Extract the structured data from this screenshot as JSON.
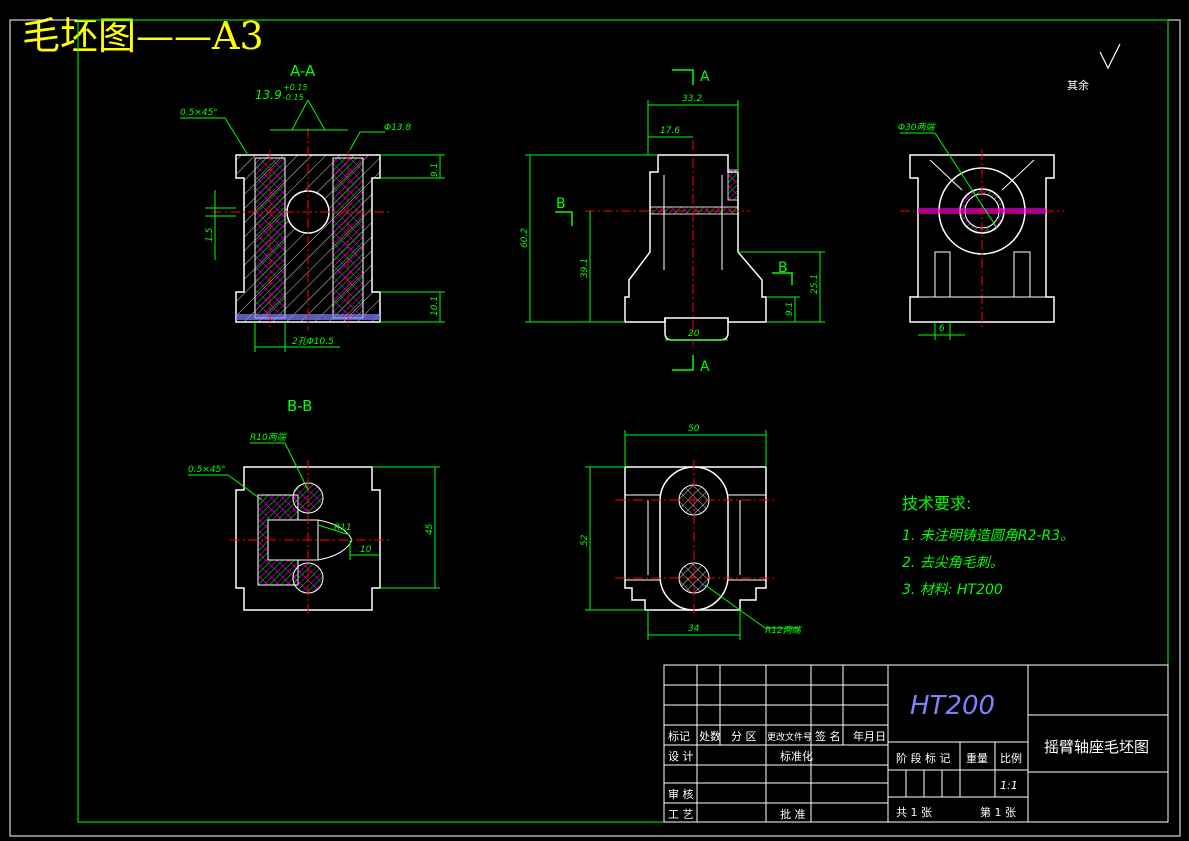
{
  "sheet_header": "毛坯图——A3",
  "views": {
    "section_aa": {
      "title": "A-A",
      "chamfer": "0.5×45°",
      "tolerance_dim": "13.9",
      "tol_upper": "+0.15",
      "tol_lower": "-0.15",
      "dia_hole": "Φ13.8",
      "dim_top_right": "9.1",
      "dim_bottom_right": "10.1",
      "dim_left": "1.5",
      "dim_bottom": "2孔Φ10.5"
    },
    "front": {
      "cut_a_top": "A",
      "cut_a_bottom": "A",
      "cut_b_left": "B",
      "cut_b_right": "B",
      "dim_width": "33.2",
      "dim_offset": "17.6",
      "dim_height": "60.2",
      "dim_mid_height": "39.1",
      "dim_right_height": "25.1",
      "dim_foot": "9.1",
      "dim_base": "20"
    },
    "side": {
      "note_bore": "Φ30两端",
      "dim_slot": "6"
    },
    "section_bb": {
      "title": "B-B",
      "radius_note": "R10两端",
      "chamfer": "0.5×45°",
      "radius_inner": "R11",
      "dim_depth": "10",
      "dim_height": "45"
    },
    "top": {
      "dim_width": "50",
      "dim_height": "52",
      "dim_centers": "34",
      "radius_note": "R12两端"
    },
    "roughness": {
      "label": "其余"
    }
  },
  "requirements": {
    "title": "技术要求:",
    "items": [
      "1. 未注明铸造圆角R2-R3。",
      "2. 去尖角毛刺。",
      "3. 材料: HT200"
    ]
  },
  "title_block": {
    "material": "HT200",
    "part_name": "摇臂轴座毛坯图",
    "headers": [
      "标记",
      "处数",
      "分 区",
      "更改文件号",
      "签 名",
      "年月日"
    ],
    "design": "设 计",
    "standardize": "标准化",
    "review": "审 核",
    "process": "工 艺",
    "approve": "批 准",
    "stage_mark": "阶 段 标 记",
    "weight": "重量",
    "scale_label": "比例",
    "scale_value": "1:1",
    "total_sheets": "共 1  张",
    "sheet_no": "第 1  张"
  },
  "colors": {
    "outline": "#ffffff",
    "dimension": "#00ff00",
    "center": "#ff0000",
    "hatch": "#ff00ff",
    "hatch2": "#8080ff",
    "header": "#ffff00"
  }
}
